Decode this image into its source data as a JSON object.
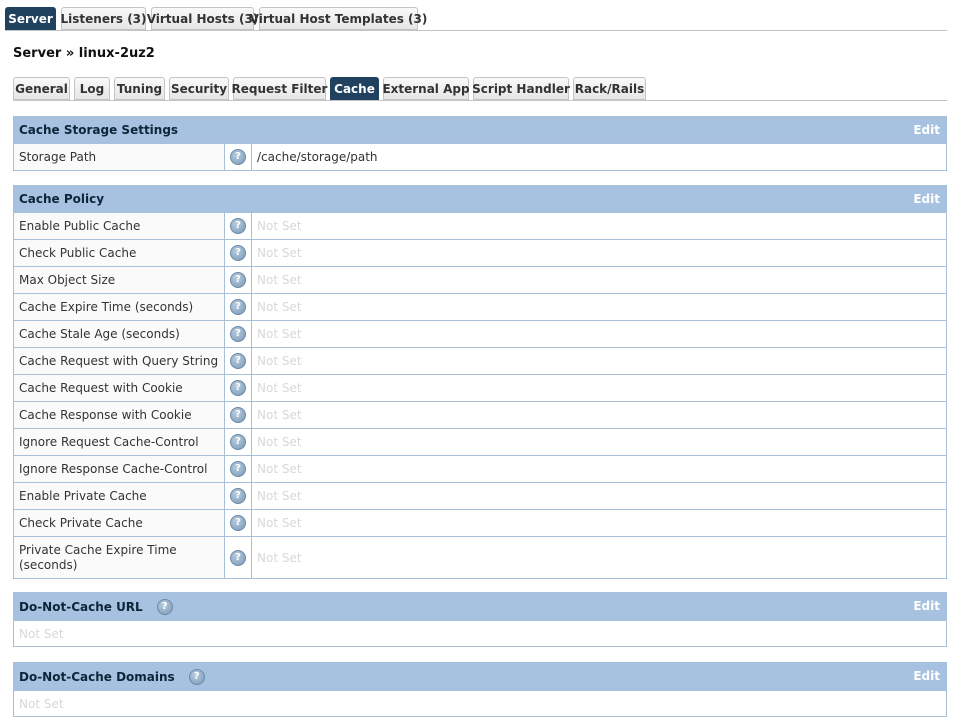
{
  "top_tabs": [
    {
      "label": "Server",
      "active": true
    },
    {
      "label": "Listeners (3)",
      "active": false
    },
    {
      "label": "Virtual Hosts (3)",
      "active": false
    },
    {
      "label": "Virtual Host Templates (3)",
      "active": false
    }
  ],
  "breadcrumb": "Server » linux-2uz2",
  "sub_tabs": [
    {
      "label": "General"
    },
    {
      "label": "Log"
    },
    {
      "label": "Tuning"
    },
    {
      "label": "Security"
    },
    {
      "label": "Request Filter"
    },
    {
      "label": "Cache",
      "active": true
    },
    {
      "label": "External App"
    },
    {
      "label": "Script Handler"
    },
    {
      "label": "Rack/Rails"
    }
  ],
  "help_glyph": "?",
  "edit_label": "Edit",
  "storage": {
    "title": "Cache Storage Settings",
    "rows": [
      {
        "label": "Storage Path",
        "value": "/cache/storage/path"
      }
    ]
  },
  "policy": {
    "title": "Cache Policy",
    "not_set": "Not Set",
    "rows": [
      {
        "label": "Enable Public Cache",
        "value": "Not Set"
      },
      {
        "label": "Check Public Cache",
        "value": "Not Set"
      },
      {
        "label": "Max Object Size",
        "value": "Not Set"
      },
      {
        "label": "Cache Expire Time (seconds)",
        "value": "Not Set"
      },
      {
        "label": "Cache Stale Age (seconds)",
        "value": "Not Set"
      },
      {
        "label": "Cache Request with Query String",
        "value": "Not Set"
      },
      {
        "label": "Cache Request with Cookie",
        "value": "Not Set"
      },
      {
        "label": "Cache Response with Cookie",
        "value": "Not Set"
      },
      {
        "label": "Ignore Request Cache-Control",
        "value": "Not Set"
      },
      {
        "label": "Ignore Response Cache-Control",
        "value": "Not Set"
      },
      {
        "label": "Enable Private Cache",
        "value": "Not Set"
      },
      {
        "label": "Check Private Cache",
        "value": "Not Set"
      },
      {
        "label": "Private Cache Expire Time (seconds)",
        "value": "Not Set"
      }
    ]
  },
  "no_cache_url": {
    "title": "Do-Not-Cache URL",
    "value": "Not Set"
  },
  "no_cache_domains": {
    "title": "Do-Not-Cache Domains",
    "value": "Not Set"
  }
}
